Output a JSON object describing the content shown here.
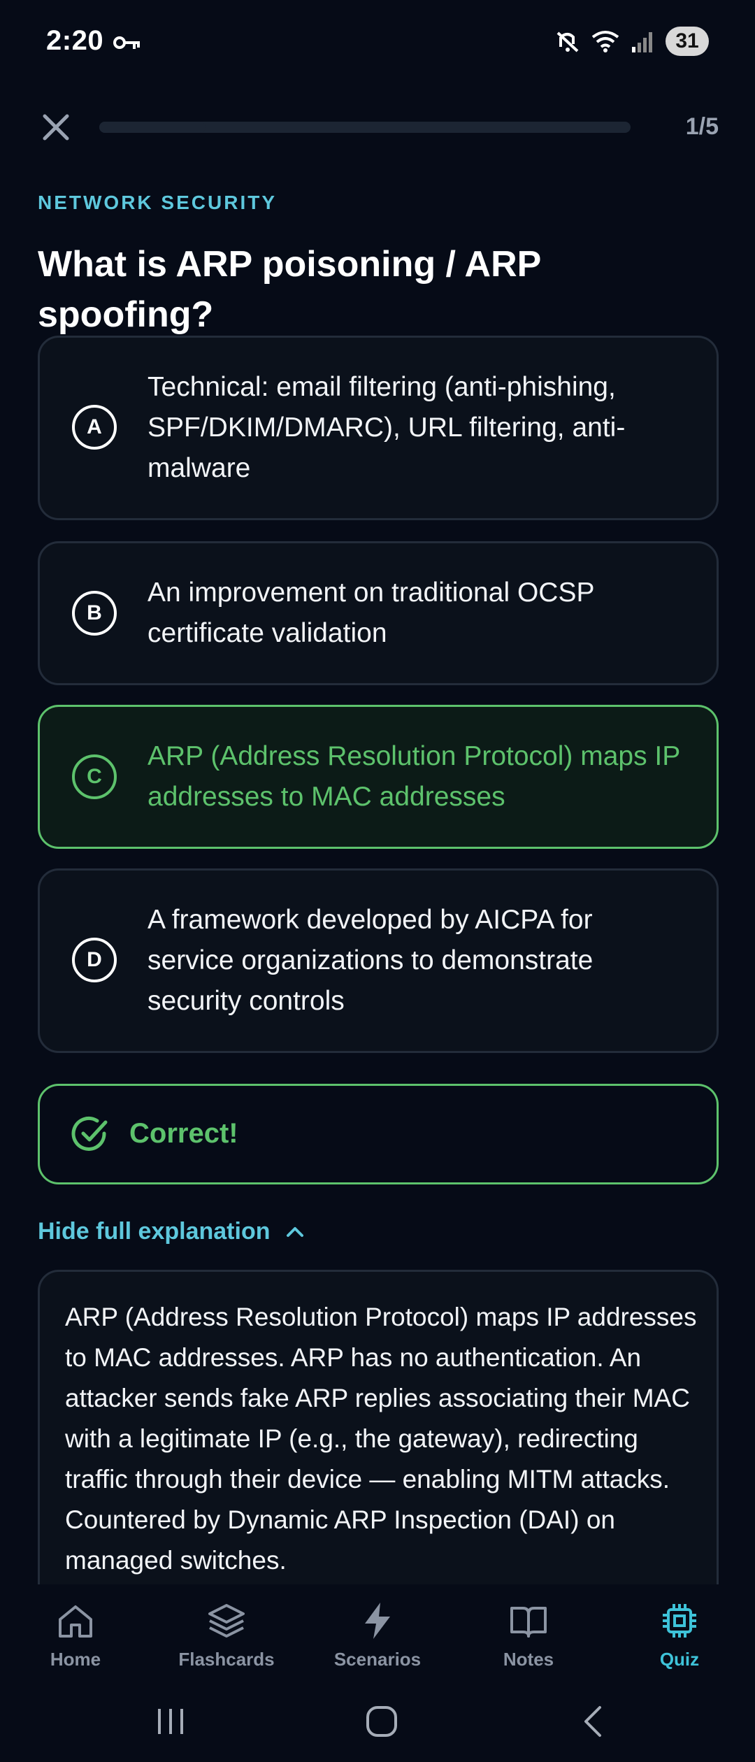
{
  "status_bar": {
    "time": "2:20",
    "battery": "31"
  },
  "quiz": {
    "progress_text": "1/5",
    "progress_fraction": 0.2,
    "category": "NETWORK SECURITY",
    "question": "What is ARP poisoning / ARP spoofing?",
    "options": [
      {
        "letter": "A",
        "text": "Technical: email filtering (anti-phishing, SPF/DKIM/DMARC), URL filtering, anti-malware",
        "state": "default"
      },
      {
        "letter": "B",
        "text": "An improvement on traditional OCSP certificate validation",
        "state": "default"
      },
      {
        "letter": "C",
        "text": "ARP (Address Resolution Protocol) maps IP addresses to MAC addresses",
        "state": "correct"
      },
      {
        "letter": "D",
        "text": "A framework developed by AICPA for service organizations to demonstrate security controls",
        "state": "default"
      }
    ],
    "result_label": "Correct!",
    "explanation_toggle": "Hide full explanation",
    "explanation": "ARP (Address Resolution Protocol) maps IP addresses to MAC addresses. ARP has no authentication. An attacker sends fake ARP replies associating their MAC with a legitimate IP (e.g., the gateway), redirecting traffic through their device — enabling MITM attacks. Countered by Dynamic ARP Inspection (DAI) on managed switches."
  },
  "bottom_nav": {
    "items": [
      {
        "label": "Home",
        "icon": "home-icon",
        "active": false
      },
      {
        "label": "Flashcards",
        "icon": "layers-icon",
        "active": false
      },
      {
        "label": "Scenarios",
        "icon": "lightning-icon",
        "active": false
      },
      {
        "label": "Notes",
        "icon": "book-icon",
        "active": false
      },
      {
        "label": "Quiz",
        "icon": "cpu-chip-icon",
        "active": true
      }
    ]
  },
  "colors": {
    "background": "#060b17",
    "accent_cyan": "#5ec8dd",
    "correct_green": "#5dc26c",
    "card": "#0b111b",
    "card_border": "#232c3a"
  }
}
